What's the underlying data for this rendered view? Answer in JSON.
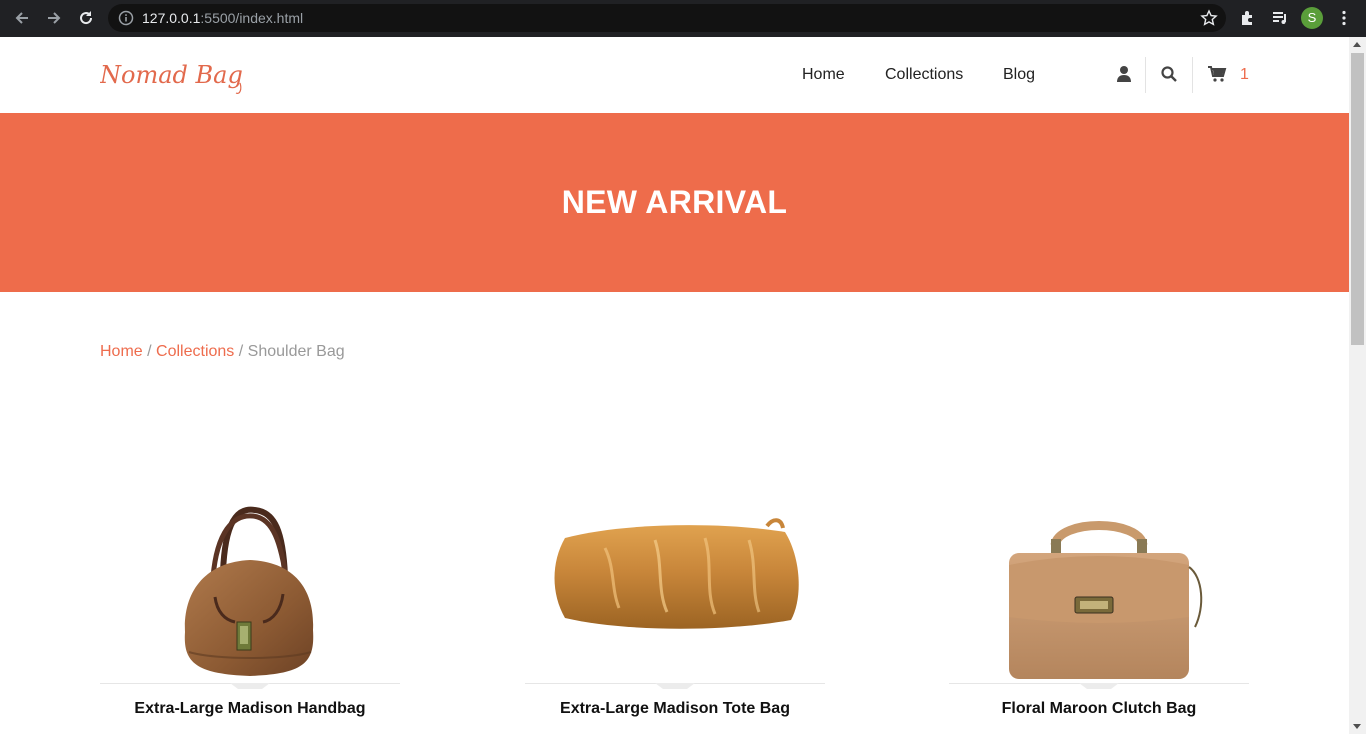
{
  "browser": {
    "url_host": "127.0.0.1",
    "url_rest": ":5500/index.html",
    "profile_initial": "S"
  },
  "site": {
    "logo_text": "Nomad Bag",
    "nav": [
      "Home",
      "Collections",
      "Blog"
    ],
    "cart_count": "1",
    "accent_color": "#ee6c4d"
  },
  "banner": {
    "title": "NEW ARRIVAL",
    "color": "#ee6c4b"
  },
  "breadcrumb": {
    "items": [
      "Home",
      "Collections"
    ],
    "separator": "/",
    "current": "Shoulder Bag"
  },
  "products": [
    {
      "name": "Extra-Large Madison Handbag",
      "icon": "brown-handbag-image"
    },
    {
      "name": "Extra-Large Madison Tote Bag",
      "icon": "gold-clutch-image"
    },
    {
      "name": "Floral Maroon Clutch Bag",
      "icon": "tan-satchel-image"
    }
  ]
}
